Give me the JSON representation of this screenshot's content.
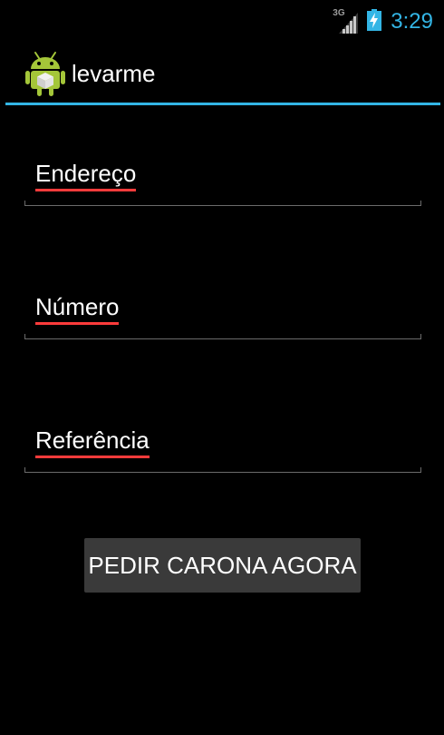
{
  "status_bar": {
    "network_type": "3G",
    "network_icon": "signal-icon",
    "battery_icon": "battery-charging-icon",
    "time": "3:29",
    "clock_color": "#33b5e5"
  },
  "action_bar": {
    "app_icon": "android-icon",
    "title": "levarme",
    "accent_color": "#33b5e5"
  },
  "form": {
    "fields": [
      {
        "text": "Endereço"
      },
      {
        "text": "Número"
      },
      {
        "text": "Referência"
      }
    ],
    "submit_label": "PEDIR CARONA AGORA",
    "spellcheck_color": "#ff3b3b"
  }
}
